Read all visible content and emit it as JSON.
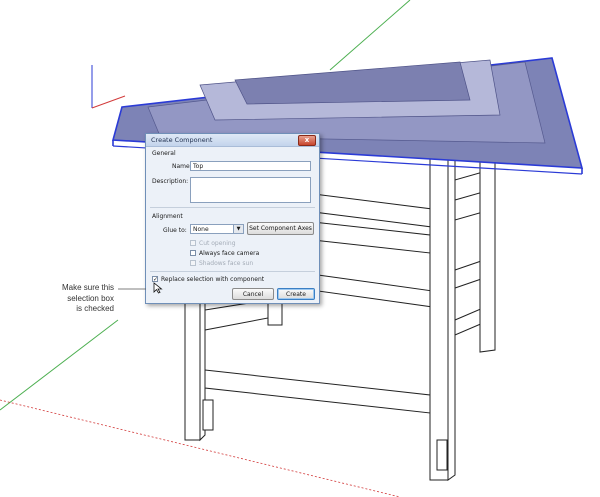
{
  "dialog": {
    "title": "Create Component",
    "close_glyph": "x",
    "general_label": "General",
    "name_label": "Name:",
    "name_value": "Top",
    "description_label": "Description:",
    "description_value": "",
    "alignment_label": "Alignment",
    "glue_label": "Glue to:",
    "glue_selected": "None",
    "set_axes_label": "Set Component Axes",
    "cut_opening_label": "Cut opening",
    "always_face_camera_label": "Always face camera",
    "shadows_face_sun_label": "Shadows face sun",
    "replace_selection_label": "Replace selection with component",
    "replace_selection_checked": true,
    "cancel_label": "Cancel",
    "create_label": "Create"
  },
  "callout": {
    "line1": "Make sure this",
    "line2": "selection box",
    "line3": "is checked"
  },
  "colors": {
    "axis_red": "#d23a3a",
    "axis_green": "#4caf50",
    "axis_blue": "#2b3bd6",
    "selection_fill": "#7d83b6",
    "wood_face": "#ffffff",
    "wood_edge": "#222222"
  },
  "icons": [
    "close-icon",
    "dropdown-arrow-icon",
    "checkbox-check-icon",
    "mouse-cursor-icon"
  ]
}
